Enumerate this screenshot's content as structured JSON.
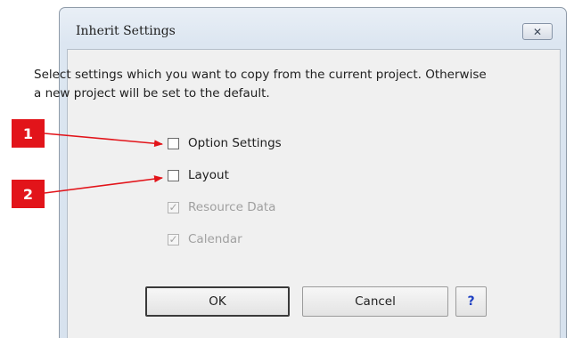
{
  "dialog": {
    "title": "Inherit Settings",
    "close_label": "✕",
    "description": "Select settings which you want to copy from the current project. Otherwise a new project will be set to the default."
  },
  "options": [
    {
      "label": "Option Settings",
      "checked": false,
      "enabled": true
    },
    {
      "label": "Layout",
      "checked": false,
      "enabled": true
    },
    {
      "label": "Resource Data",
      "checked": true,
      "enabled": false
    },
    {
      "label": "Calendar",
      "checked": true,
      "enabled": false
    }
  ],
  "buttons": {
    "ok": "OK",
    "cancel": "Cancel",
    "help": "?"
  },
  "annotations": [
    {
      "number": "1"
    },
    {
      "number": "2"
    }
  ],
  "colors": {
    "marker": "#e2141a",
    "help_text": "#1d3fc2",
    "dialog_frame": "#dce6f1"
  }
}
